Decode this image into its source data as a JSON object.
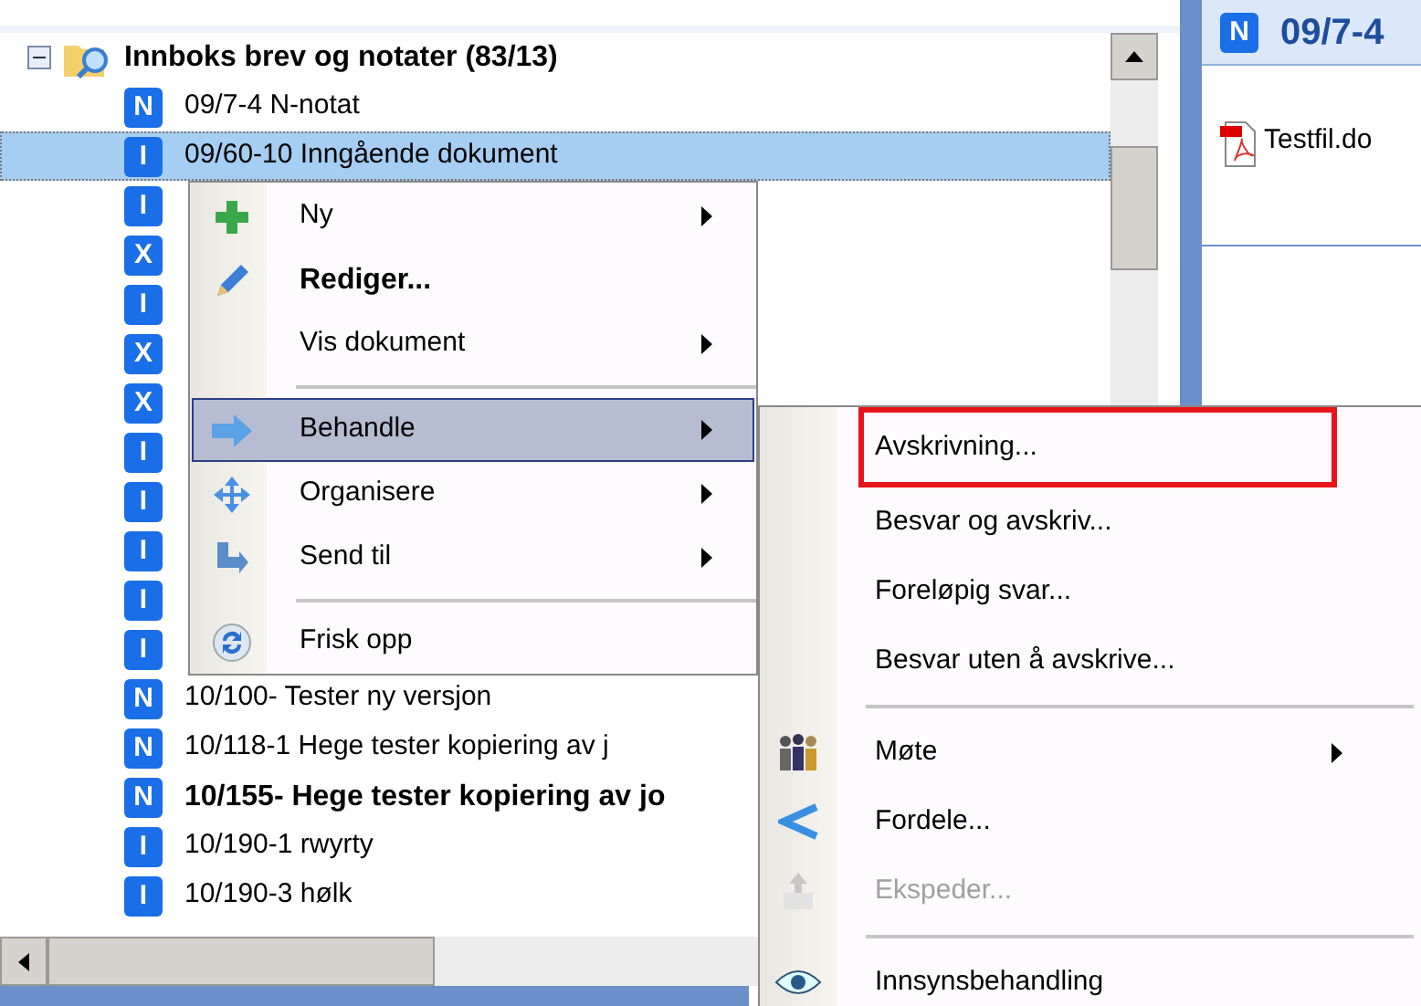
{
  "tree": {
    "root": {
      "label": "Innboks brev og notater (83/13)",
      "expanded": true,
      "children": [
        {
          "badge": "N",
          "label": "09/7-4 N-notat",
          "selected": false,
          "bold": false
        },
        {
          "badge": "I",
          "label": "09/60-10 Inngående dokument",
          "selected": true,
          "bold": false
        },
        {
          "badge": "I",
          "selected": false
        },
        {
          "badge": "X",
          "selected": false
        },
        {
          "badge": "I",
          "selected": false
        },
        {
          "badge": "X",
          "selected": false
        },
        {
          "badge": "X",
          "selected": false
        },
        {
          "badge": "I",
          "selected": false
        },
        {
          "badge": "I",
          "selected": false
        },
        {
          "badge": "I",
          "selected": false
        },
        {
          "badge": "I",
          "selected": false
        },
        {
          "badge": "I",
          "selected": false
        },
        {
          "badge": "N",
          "label": "10/100- Tester ny versjon",
          "selected": false,
          "bold": false
        },
        {
          "badge": "N",
          "label": "10/118-1 Hege tester kopiering av j",
          "selected": false,
          "bold": false
        },
        {
          "badge": "N",
          "label": "10/155- Hege tester kopiering av jo",
          "selected": false,
          "bold": true
        },
        {
          "badge": "I",
          "label": "10/190-1 rwyrty",
          "selected": false,
          "bold": false
        },
        {
          "badge": "I",
          "label": "10/190-3 hølk",
          "selected": false,
          "bold": false
        }
      ]
    }
  },
  "preview": {
    "badge": "N",
    "title": "09/7-4",
    "attachment": "Testfil.do"
  },
  "context_menu": [
    {
      "kind": "item",
      "label": "Ny",
      "submenu": true,
      "bold": false,
      "selected": false
    },
    {
      "kind": "item",
      "label": "Rediger...",
      "submenu": false,
      "bold": true,
      "selected": false
    },
    {
      "kind": "item",
      "label": "Vis dokument",
      "submenu": true,
      "bold": false,
      "selected": false
    },
    {
      "kind": "separator"
    },
    {
      "kind": "item",
      "label": "Behandle",
      "submenu": true,
      "bold": false,
      "selected": true
    },
    {
      "kind": "item",
      "label": "Organisere",
      "submenu": true,
      "bold": false,
      "selected": false
    },
    {
      "kind": "item",
      "label": "Send til",
      "submenu": true,
      "bold": false,
      "selected": false
    },
    {
      "kind": "separator"
    },
    {
      "kind": "item",
      "label": "Frisk opp",
      "submenu": false,
      "bold": false,
      "selected": false
    }
  ],
  "submenu": [
    {
      "kind": "item",
      "label": "Avskrivning...",
      "submenu": false,
      "disabled": false,
      "marked": true
    },
    {
      "kind": "item",
      "label": "Besvar og avskriv...",
      "submenu": false,
      "disabled": false,
      "marked": false
    },
    {
      "kind": "item",
      "label": "Foreløpig svar...",
      "submenu": false,
      "disabled": false,
      "marked": false
    },
    {
      "kind": "item",
      "label": "Besvar uten å avskrive...",
      "submenu": false,
      "disabled": false,
      "marked": false
    },
    {
      "kind": "separator"
    },
    {
      "kind": "item",
      "label": "Møte",
      "submenu": true,
      "disabled": false,
      "marked": false
    },
    {
      "kind": "item",
      "label": "Fordele...",
      "submenu": false,
      "disabled": false,
      "marked": false
    },
    {
      "kind": "item",
      "label": "Ekspeder...",
      "submenu": false,
      "disabled": true,
      "marked": false
    },
    {
      "kind": "separator"
    },
    {
      "kind": "item",
      "label": "Innsynsbehandling",
      "submenu": false,
      "disabled": false,
      "marked": false
    }
  ]
}
